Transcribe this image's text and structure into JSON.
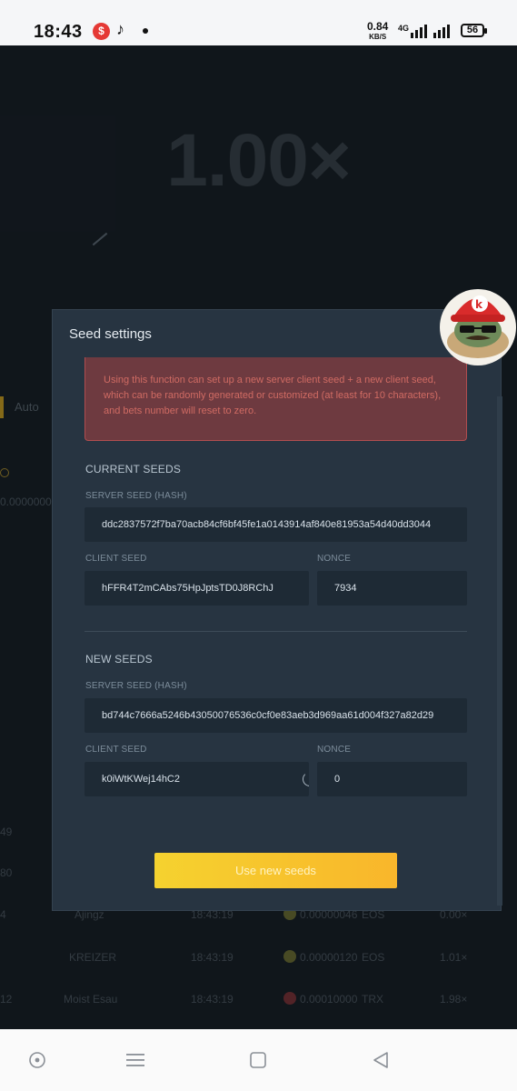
{
  "status_bar": {
    "time": "18:43",
    "speed_value": "0.84",
    "speed_unit": "KB/S",
    "network": "4G",
    "battery": "56"
  },
  "game": {
    "multiplier": "1.00×",
    "auto_label": "Auto",
    "balance_partial": "0.00000000",
    "rows": [
      {
        "left": "49",
        "player": "",
        "time": "",
        "amount": "",
        "currency": "",
        "mult": ""
      },
      {
        "left": "80",
        "player": "",
        "time": "",
        "amount": "",
        "currency": "",
        "mult": ""
      },
      {
        "left": "4",
        "player": "Ajingz",
        "time": "18:43:19",
        "amount": "0.00000046",
        "currency": "EOS",
        "mult": "0.00×"
      },
      {
        "left": "",
        "player": "KREIZER",
        "time": "18:43:19",
        "amount": "0.00000120",
        "currency": "EOS",
        "mult": "1.01×"
      },
      {
        "left": "12",
        "player": "Moist Esau",
        "time": "18:43:19",
        "amount": "0.00010000",
        "currency": "TRX",
        "mult": "1.98×"
      }
    ]
  },
  "modal": {
    "title": "Seed settings",
    "warning": "Using this function can set up a new server client seed + a new client seed, which can be randomly generated or customized (at least for 10 characters), and bets number will reset to zero.",
    "current": {
      "section_title": "CURRENT SEEDS",
      "server_seed_label": "SERVER SEED (HASH)",
      "server_seed": "ddc2837572f7ba70acb84cf6bf45fe1a0143914af840e81953a54d40dd3044",
      "client_seed_label": "CLIENT SEED",
      "client_seed": "hFFR4T2mCAbs75HpJptsTD0J8RChJ",
      "nonce_label": "NONCE",
      "nonce": "7934"
    },
    "new": {
      "section_title": "NEW SEEDS",
      "server_seed_label": "SERVER SEED (HASH)",
      "server_seed": "bd744c7666a5246b43050076536c0cf0e83aeb3d969aa61d004f327a82d29",
      "client_seed_label": "CLIENT SEED",
      "client_seed": "k0iWtKWej14hC2",
      "nonce_label": "NONCE",
      "nonce": "0"
    },
    "use_button": "Use new seeds"
  },
  "colors": {
    "accent_yellow": "#f5d22f",
    "warning_bg": "#6e3a40",
    "modal_bg": "#273441"
  },
  "icons": {
    "refresh": "refresh-icon",
    "mascot": "mascot-avatar"
  }
}
